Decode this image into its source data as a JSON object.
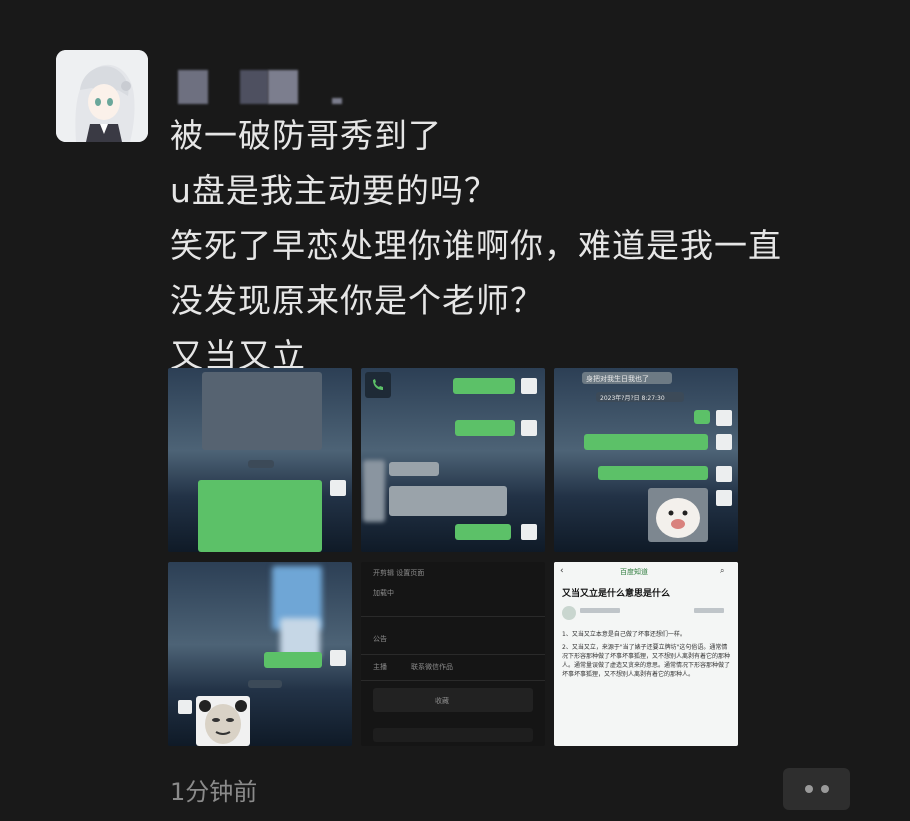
{
  "post": {
    "lines": [
      "被一破防哥秀到了",
      "u盘是我主动要的吗？",
      "笑死了早恋处理你谁啊你，难道是我一直",
      "没发现原来你是个老师？",
      "又当又立"
    ],
    "time": "1分钟前"
  },
  "images": {
    "img3_header": "身把对我生日我也了",
    "img3_date": "2023年?月?日 8:27:30",
    "img5_row1": "开剪辑    设置页面",
    "img5_menu": [
      "加载中",
      "公告",
      "收藏"
    ],
    "img5_row2": "主播",
    "img5_row2b": "联系微信作品",
    "img6_brand": "百度知道",
    "img6_title": "又当又立是什么意思是什么",
    "img6_answer_1": "1、又当又立本意是自己做了坏事还想们一样。",
    "img6_answer_2": "2、又当又立，来源于\"当了婊子还要立牌坊\"这句俗语。通常情况下形容那种做了坏事坏事狐狸，又不想别人离剥有着它的那种人。通常量误做了虚造又贪来的意思。通常情况下形容那种做了坏事坏事狐狸，又不想别人离剥有着它的那种人。"
  },
  "colors": {
    "background": "#191919",
    "text": "#e6e6e6",
    "meta": "#8b8b8b",
    "wechat_green": "#5cc168"
  },
  "icons": {
    "more": "more-dots-icon"
  }
}
